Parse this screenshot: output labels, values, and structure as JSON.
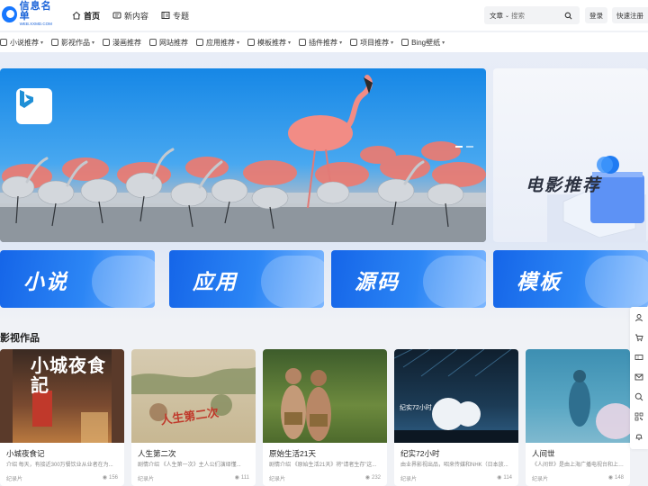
{
  "logo": {
    "main": "信息名单",
    "sub": "WEB.XXMD.COM"
  },
  "topnav": [
    {
      "label": "首页",
      "icon": "home-icon",
      "active": true
    },
    {
      "label": "新内容",
      "icon": "news-icon",
      "active": false
    },
    {
      "label": "专题",
      "icon": "topic-icon",
      "active": false
    }
  ],
  "search": {
    "category": "文章",
    "placeholder": "搜索"
  },
  "header_buttons": {
    "login": "登录",
    "quick": "快速注册"
  },
  "categories": [
    {
      "label": "小说推荐",
      "icon": "book-icon"
    },
    {
      "label": "影视作品",
      "icon": "video-icon"
    },
    {
      "label": "漫画推荐",
      "icon": "comic-icon"
    },
    {
      "label": "网站推荐",
      "icon": "link-icon"
    },
    {
      "label": "应用推荐",
      "icon": "app-icon"
    },
    {
      "label": "模板推荐",
      "icon": "template-icon"
    },
    {
      "label": "插件推荐",
      "icon": "plugin-icon"
    },
    {
      "label": "项目推荐",
      "icon": "project-icon"
    },
    {
      "label": "Bing壁纸",
      "icon": "image-icon"
    }
  ],
  "promo": {
    "title": "电影推荐"
  },
  "tiles": [
    {
      "label": "小说"
    },
    {
      "label": "应用"
    },
    {
      "label": "源码"
    },
    {
      "label": "模板"
    }
  ],
  "section": {
    "title": "影视作品"
  },
  "cards": [
    {
      "title": "小城夜食记",
      "desc": "介绍 每天，有接近300万餐饮业从业者在为...",
      "tag": "纪录片",
      "views": "156",
      "poster_text": "小城夜食記"
    },
    {
      "title": "人生第二次",
      "desc": "剧情介绍 《人生第一次》主人公们演绎懂...",
      "tag": "纪录片",
      "views": "111",
      "poster_text": "人生第二次"
    },
    {
      "title": "原始生活21天",
      "desc": "剧情介绍 《原始生活21天》将“请者生存”这...",
      "tag": "纪录片",
      "views": "232",
      "poster_text": ""
    },
    {
      "title": "纪实72小时",
      "desc": "由业界影视出品，昭来传媒和NHK（日本放...",
      "tag": "纪录片",
      "views": "114",
      "poster_text": "纪实72小时"
    },
    {
      "title": "人间世",
      "desc": "《人间世》是由上海广播电视台和上海市卫...",
      "tag": "纪录片",
      "views": "148",
      "poster_text": ""
    }
  ],
  "right_rail": [
    "user-icon",
    "cart-icon",
    "ticket-icon",
    "mail-icon",
    "search-icon",
    "qrcode-icon",
    "bell-icon"
  ],
  "colors": {
    "brand": "#1677ff",
    "banner_blue": "#1687e6",
    "tile_blue": "#1565e8"
  }
}
